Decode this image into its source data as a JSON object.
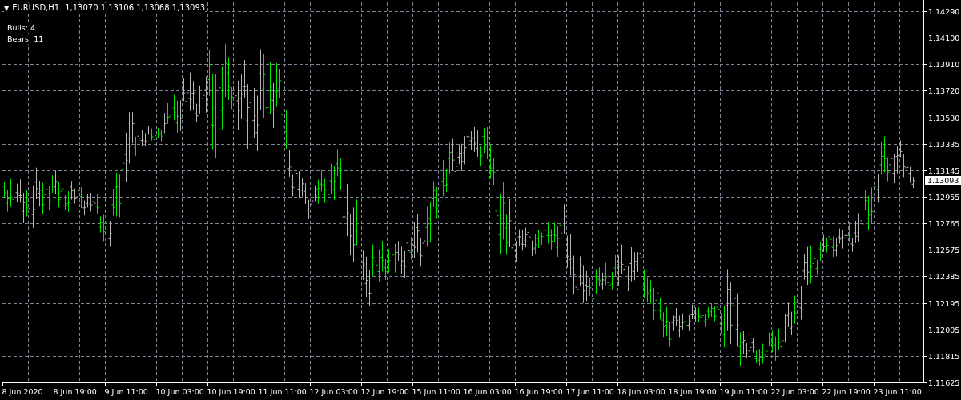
{
  "header": {
    "toggle": "▼",
    "symbol": "EURUSD,H1",
    "quote": "1,13070 1,13106 1,13068 1,13093"
  },
  "counters": [
    {
      "label": "Bulls: 4"
    },
    {
      "label": "Bears: 11"
    }
  ],
  "price_axis": {
    "labels": [
      "1.14290",
      "1.14100",
      "1.13910",
      "1.13720",
      "1.13530",
      "1.13335",
      "1.13145",
      "1.12955",
      "1.12765",
      "1.12575",
      "1.12385",
      "1.12195",
      "1.12005",
      "1.11815",
      "1.11625"
    ]
  },
  "time_axis": {
    "labels": [
      "8 Jun 2020",
      "8 Jun 19:00",
      "9 Jun 11:00",
      "10 Jun 03:00",
      "10 Jun 19:00",
      "11 Jun 11:00",
      "12 Jun 03:00",
      "12 Jun 19:00",
      "15 Jun 11:00",
      "16 Jun 03:00",
      "16 Jun 19:00",
      "17 Jun 11:00",
      "18 Jun 03:00",
      "18 Jun 19:00",
      "19 Jun 11:00",
      "22 Jun 03:00",
      "22 Jun 19:00",
      "23 Jun 11:00"
    ]
  },
  "current_price": {
    "label": "1.13093"
  }
}
